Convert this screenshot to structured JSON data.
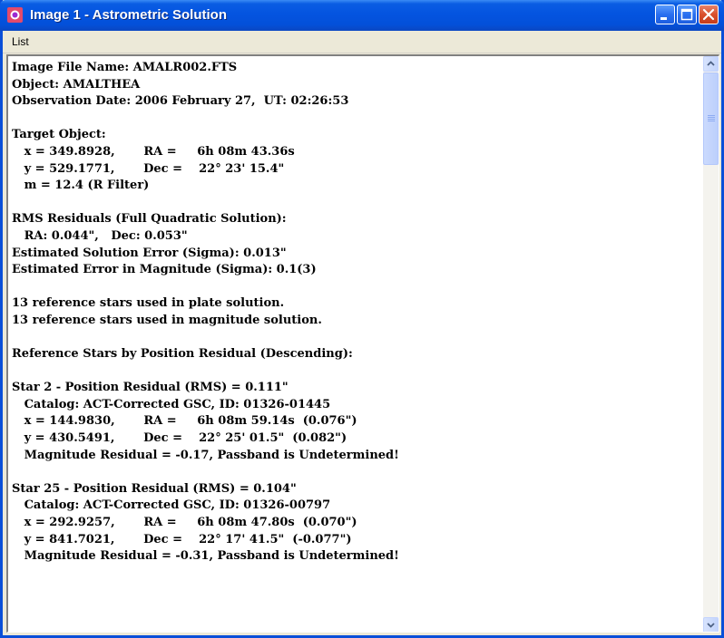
{
  "window": {
    "title": "Image 1 - Astrometric Solution",
    "accent": "#0454e0"
  },
  "menu": {
    "items": [
      "List"
    ]
  },
  "report": {
    "lines": [
      "Image File Name: AMALR002.FTS",
      "Object: AMALTHEA",
      "Observation Date: 2006 February 27,  UT: 02:26:53",
      "",
      "Target Object:",
      "   x = 349.8928,       RA =     6h 08m 43.36s",
      "   y = 529.1771,       Dec =    22° 23' 15.4\"",
      "   m = 12.4 (R Filter)",
      "",
      "RMS Residuals (Full Quadratic Solution):",
      "   RA: 0.044\",   Dec: 0.053\"",
      "Estimated Solution Error (Sigma): 0.013\"",
      "Estimated Error in Magnitude (Sigma): 0.1(3)",
      "",
      "13 reference stars used in plate solution.",
      "13 reference stars used in magnitude solution.",
      "",
      "Reference Stars by Position Residual (Descending):",
      "",
      "Star 2 - Position Residual (RMS) = 0.111\"",
      "   Catalog: ACT-Corrected GSC, ID: 01326-01445",
      "   x = 144.9830,       RA =     6h 08m 59.14s  (0.076\")",
      "   y = 430.5491,       Dec =    22° 25' 01.5\"  (0.082\")",
      "   Magnitude Residual = -0.17, Passband is Undetermined!",
      "",
      "Star 25 - Position Residual (RMS) = 0.104\"",
      "   Catalog: ACT-Corrected GSC, ID: 01326-00797",
      "   x = 292.9257,       RA =     6h 08m 47.80s  (0.070\")",
      "   y = 841.7021,       Dec =    22° 17' 41.5\"  (-0.077\")",
      "   Magnitude Residual = -0.31, Passband is Undetermined!"
    ]
  },
  "scrollbar": {
    "position_fraction": 0.0
  }
}
